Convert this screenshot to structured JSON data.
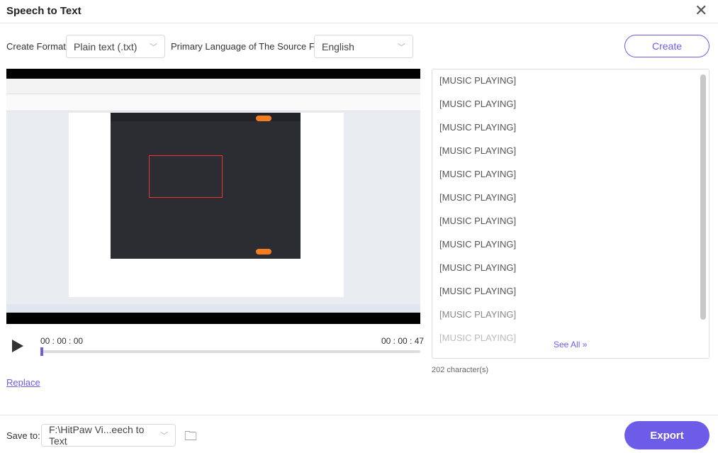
{
  "title": "Speech to Text",
  "format": {
    "label": "Create Format:",
    "value": "Plain text (.txt)"
  },
  "language": {
    "label": "Primary Language of The Source File:",
    "value": "English"
  },
  "create_label": "Create",
  "player": {
    "current": "00 : 00 : 00",
    "duration": "00 : 00 : 47",
    "progress": 0
  },
  "replace_label": "Replace",
  "transcript": [
    "[MUSIC PLAYING]",
    "[MUSIC PLAYING]",
    "[MUSIC PLAYING]",
    "[MUSIC PLAYING]",
    "[MUSIC PLAYING]",
    "[MUSIC PLAYING]",
    "[MUSIC PLAYING]",
    "[MUSIC PLAYING]",
    "[MUSIC PLAYING]",
    "[MUSIC PLAYING]",
    "[MUSIC PLAYING]",
    "[MUSIC PLAYING]"
  ],
  "see_all": "See All",
  "char_count": "202 character(s)",
  "save": {
    "label": "Save to:",
    "path": "F:\\HitPaw Vi...eech to Text"
  },
  "export_label": "Export",
  "accent": "#6c5ce7"
}
